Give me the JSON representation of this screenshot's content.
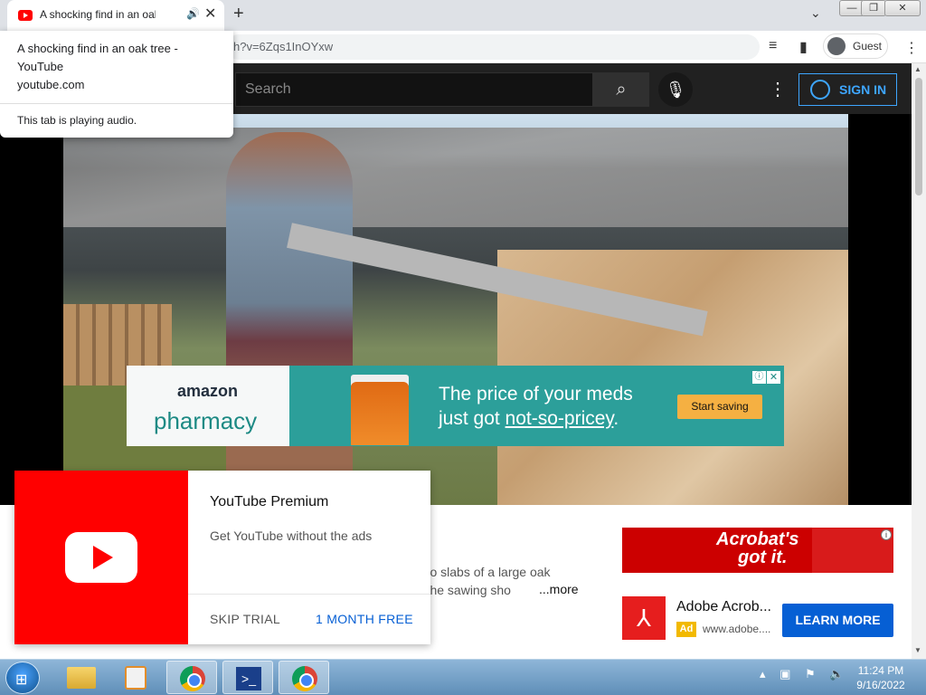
{
  "browser": {
    "tab_title": "A shocking find in an oak tree",
    "address": "h?v=6Zqs1InOYxw",
    "profile_label": "Guest",
    "hover_card": {
      "title": "A shocking find in an oak tree - YouTube",
      "domain": "youtube.com",
      "audio_note": "This tab is playing audio."
    }
  },
  "youtube": {
    "search_placeholder": "Search",
    "sign_in_label": "SIGN IN",
    "ad_banner": {
      "brand": "amazon",
      "product": "pharmacy",
      "line1": "The price of your meds",
      "line2_prefix": "just got ",
      "line2_underlined": "not-so-pricey",
      "line2_suffix": ".",
      "cta": "Start saving"
    },
    "description_line1": "g into slabs of a large oak",
    "description_line2": "l of the sawing sho",
    "more_label": "...more",
    "promo": {
      "title": "YouTube Premium",
      "subtitle": "Get YouTube without the ads",
      "skip_label": "SKIP TRIAL",
      "free_label": "1 MONTH FREE"
    },
    "side_ad": {
      "banner_line1": "Acrobat's",
      "banner_line2": "got it.",
      "title": "Adobe Acrob...",
      "ad_badge": "Ad",
      "url": "www.adobe....",
      "cta": "LEARN MORE"
    }
  },
  "taskbar": {
    "time": "11:24 PM",
    "date": "9/16/2022"
  }
}
